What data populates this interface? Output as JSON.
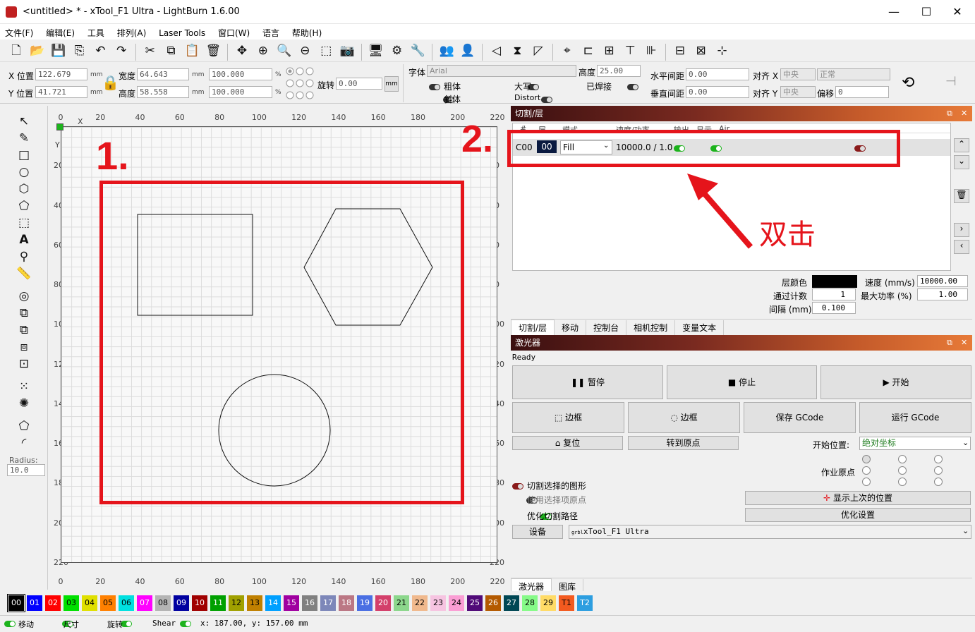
{
  "window": {
    "title": "<untitled> * - xTool_F1 Ultra - LightBurn 1.6.00",
    "minimize": "—",
    "maximize": "☐",
    "close": "✕"
  },
  "menu": [
    "文件(F)",
    "编辑(E)",
    "工具",
    "排列(A)",
    "Laser Tools",
    "窗口(W)",
    "语言",
    "帮助(H)"
  ],
  "props": {
    "x_label": "X 位置",
    "x_val": "122.679",
    "y_label": "Y 位置",
    "y_val": "41.721",
    "unit": "mm",
    "w_label": "宽度",
    "w_val": "64.643",
    "h_label": "高度",
    "h_val": "58.558",
    "pct_w": "100.000",
    "pct_h": "100.000",
    "pct": "%",
    "rot_label": "旋转",
    "rot_val": "0.00",
    "mm_btn": "mm",
    "font_label": "字体",
    "font_val": "Arial",
    "fh_label": "高度",
    "fh_val": "25.00",
    "bold": "粗体",
    "italic": "斜体",
    "upper": "大写",
    "distort": "Distort",
    "welded": "已焊接",
    "hspace_label": "水平间距",
    "hspace_val": "0.00",
    "vspace_label": "垂直间距",
    "vspace_val": "0.00",
    "alignx_label": "对齐 X",
    "alignx_val": "中央",
    "aligny_label": "对齐 Y",
    "aligny_val": "中央",
    "normal": "正常",
    "offset_label": "偏移",
    "offset_val": "0"
  },
  "left_tools": {
    "radius_label": "Radius:",
    "radius_val": "10.0"
  },
  "ruler": {
    "top": [
      "0",
      "20",
      "40",
      "60",
      "80",
      "100",
      "120",
      "140",
      "160",
      "180",
      "200",
      "220"
    ],
    "left": [
      "20",
      "40",
      "60",
      "80",
      "100",
      "120",
      "140",
      "160",
      "180",
      "200",
      "220"
    ],
    "x": "X",
    "y": "Y"
  },
  "annotations": {
    "step1": "1.",
    "step2": "2.",
    "dbl": "双击"
  },
  "cuts_panel": {
    "title": "切割/层",
    "headers": [
      "#",
      "层",
      "模式",
      "速度/功率",
      "输出",
      "显示",
      "Air"
    ],
    "row": {
      "id": "C00",
      "layer": "00",
      "mode": "Fill",
      "speed_power": "10000.0 / 1.0"
    },
    "layer_color_label": "层颜色",
    "speed_label": "速度 (mm/s)",
    "speed_val": "10000.00",
    "passes_label": "通过计数",
    "passes_val": "1",
    "maxpower_label": "最大功率 (%)",
    "maxpower_val": "1.00",
    "interval_label": "间隔 (mm)",
    "interval_val": "0.100",
    "tabs": [
      "切割/层",
      "移动",
      "控制台",
      "相机控制",
      "变量文本"
    ]
  },
  "laser_panel": {
    "title": "激光器",
    "status": "Ready",
    "pause": "暂停",
    "stop": "停止",
    "start": "开始",
    "frame1": "边框",
    "frame2": "边框",
    "save_gcode": "保存 GCode",
    "run_gcode": "运行 GCode",
    "home": "复位",
    "goto_origin": "转到原点",
    "start_from_label": "开始位置:",
    "start_from_val": "绝对坐标",
    "job_origin_label": "作业原点",
    "cut_selected": "切割选择的图形",
    "use_sel_origin": "使用选择项原点",
    "optimize_path": "优化切割路径",
    "show_last": "显示上次的位置",
    "optimize_settings": "优化设置",
    "device_btn": "设备",
    "device_val": "xTool_F1 Ultra",
    "device_prefix": "grbl",
    "tabs": [
      "激光器",
      "图库"
    ]
  },
  "palette": [
    {
      "l": "00",
      "c": "#000000",
      "t": "#ffffff"
    },
    {
      "l": "01",
      "c": "#0000ff",
      "t": "#ffffff"
    },
    {
      "l": "02",
      "c": "#ff0000",
      "t": "#ffffff"
    },
    {
      "l": "03",
      "c": "#00e000",
      "t": "#000000"
    },
    {
      "l": "04",
      "c": "#e0e000",
      "t": "#000000"
    },
    {
      "l": "05",
      "c": "#ff8000",
      "t": "#000000"
    },
    {
      "l": "06",
      "c": "#00e0e0",
      "t": "#000000"
    },
    {
      "l": "07",
      "c": "#ff00ff",
      "t": "#ffffff"
    },
    {
      "l": "08",
      "c": "#b4b4b4",
      "t": "#000000"
    },
    {
      "l": "09",
      "c": "#0000a0",
      "t": "#ffffff"
    },
    {
      "l": "10",
      "c": "#a00000",
      "t": "#ffffff"
    },
    {
      "l": "11",
      "c": "#00a000",
      "t": "#ffffff"
    },
    {
      "l": "12",
      "c": "#a0a000",
      "t": "#000000"
    },
    {
      "l": "13",
      "c": "#c08000",
      "t": "#000000"
    },
    {
      "l": "14",
      "c": "#00a0ff",
      "t": "#ffffff"
    },
    {
      "l": "15",
      "c": "#a000a0",
      "t": "#ffffff"
    },
    {
      "l": "16",
      "c": "#808080",
      "t": "#ffffff"
    },
    {
      "l": "17",
      "c": "#7d87b9",
      "t": "#ffffff"
    },
    {
      "l": "18",
      "c": "#bb7784",
      "t": "#ffffff"
    },
    {
      "l": "19",
      "c": "#4a6fe3",
      "t": "#ffffff"
    },
    {
      "l": "20",
      "c": "#d33f6a",
      "t": "#ffffff"
    },
    {
      "l": "21",
      "c": "#8cd78c",
      "t": "#000000"
    },
    {
      "l": "22",
      "c": "#f0b98d",
      "t": "#000000"
    },
    {
      "l": "23",
      "c": "#f6c4e1",
      "t": "#000000"
    },
    {
      "l": "24",
      "c": "#fa9ed4",
      "t": "#000000"
    },
    {
      "l": "25",
      "c": "#500a78",
      "t": "#ffffff"
    },
    {
      "l": "26",
      "c": "#b45a00",
      "t": "#ffffff"
    },
    {
      "l": "27",
      "c": "#004754",
      "t": "#ffffff"
    },
    {
      "l": "28",
      "c": "#86fa88",
      "t": "#000000"
    },
    {
      "l": "29",
      "c": "#ffdb66",
      "t": "#000000"
    },
    {
      "l": "T1",
      "c": "#f35a1f",
      "t": "#000000"
    },
    {
      "l": "T2",
      "c": "#2d9ee0",
      "t": "#ffffff"
    }
  ],
  "status": {
    "move": "移动",
    "size": "尺寸",
    "rotate": "旋转",
    "shear": "Shear",
    "coords": "x: 187.00, y: 157.00 mm"
  }
}
